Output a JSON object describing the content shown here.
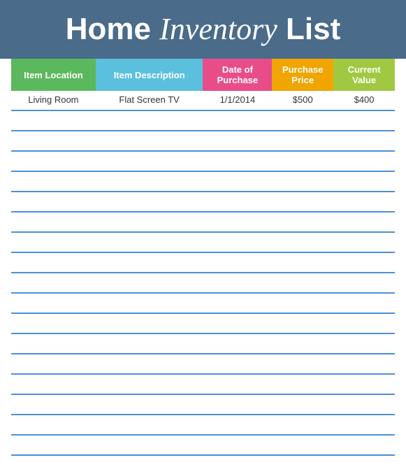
{
  "header": {
    "title_regular_1": "Home",
    "title_cursive": "Inventory",
    "title_regular_2": "List"
  },
  "columns": {
    "location": "Item Location",
    "description": "Item Description",
    "date": "Date of Purchase",
    "purchase_price": "Purchase Price",
    "current_value": "Current Value"
  },
  "rows": [
    {
      "location": "Living Room",
      "description": "Flat Screen TV",
      "date": "1/1/2014",
      "purchase_price": "$500",
      "current_value": "$400"
    },
    {
      "location": "",
      "description": "",
      "date": "",
      "purchase_price": "",
      "current_value": ""
    },
    {
      "location": "",
      "description": "",
      "date": "",
      "purchase_price": "",
      "current_value": ""
    },
    {
      "location": "",
      "description": "",
      "date": "",
      "purchase_price": "",
      "current_value": ""
    },
    {
      "location": "",
      "description": "",
      "date": "",
      "purchase_price": "",
      "current_value": ""
    },
    {
      "location": "",
      "description": "",
      "date": "",
      "purchase_price": "",
      "current_value": ""
    },
    {
      "location": "",
      "description": "",
      "date": "",
      "purchase_price": "",
      "current_value": ""
    },
    {
      "location": "",
      "description": "",
      "date": "",
      "purchase_price": "",
      "current_value": ""
    },
    {
      "location": "",
      "description": "",
      "date": "",
      "purchase_price": "",
      "current_value": ""
    },
    {
      "location": "",
      "description": "",
      "date": "",
      "purchase_price": "",
      "current_value": ""
    },
    {
      "location": "",
      "description": "",
      "date": "",
      "purchase_price": "",
      "current_value": ""
    },
    {
      "location": "",
      "description": "",
      "date": "",
      "purchase_price": "",
      "current_value": ""
    },
    {
      "location": "",
      "description": "",
      "date": "",
      "purchase_price": "",
      "current_value": ""
    },
    {
      "location": "",
      "description": "",
      "date": "",
      "purchase_price": "",
      "current_value": ""
    },
    {
      "location": "",
      "description": "",
      "date": "",
      "purchase_price": "",
      "current_value": ""
    },
    {
      "location": "",
      "description": "",
      "date": "",
      "purchase_price": "",
      "current_value": ""
    },
    {
      "location": "",
      "description": "",
      "date": "",
      "purchase_price": "",
      "current_value": ""
    },
    {
      "location": "",
      "description": "",
      "date": "",
      "purchase_price": "",
      "current_value": ""
    }
  ]
}
